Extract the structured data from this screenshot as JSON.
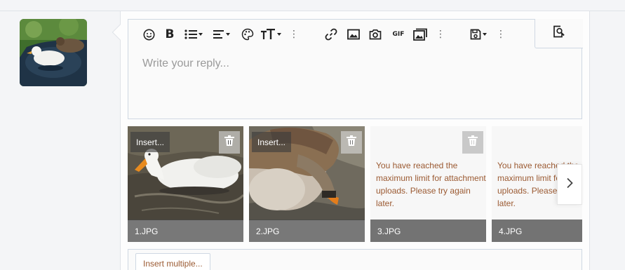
{
  "toolbar": {
    "buttons": [
      "smilie-icon",
      "bold-icon",
      "list-icon",
      "align-icon",
      "palette-icon",
      "text-size-icon",
      "more-icon",
      "link-icon",
      "image-icon",
      "camera-icon",
      "gif-icon",
      "media-icon",
      "more-icon",
      "save-draft-icon",
      "more-icon",
      "preview-icon"
    ],
    "gif_label": "GIF"
  },
  "editor": {
    "placeholder": "Write your reply..."
  },
  "attachments": {
    "insert_label": "Insert...",
    "limit_message": "You have reached the maximum limit for attachment uploads. Please try again later.",
    "items": [
      {
        "name": "1.JPG",
        "has_image": true
      },
      {
        "name": "2.JPG",
        "has_image": true
      },
      {
        "name": "3.JPG",
        "has_image": false
      },
      {
        "name": "4.JPG",
        "has_image": false
      }
    ]
  },
  "footer": {
    "insert_multiple_label": "Insert multiple..."
  },
  "colors": {
    "accent_text": "#9b5a32",
    "border": "#cfd8e3",
    "page_bg": "#f4f5f7"
  }
}
